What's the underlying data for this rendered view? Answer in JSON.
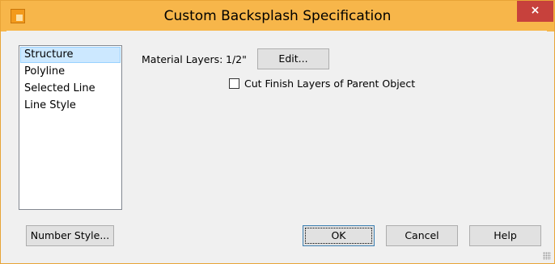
{
  "window": {
    "title": "Custom Backsplash Specification",
    "close_glyph": "×",
    "app_icon": "backsplash-app-icon"
  },
  "nav": {
    "items": [
      {
        "label": "Structure",
        "selected": true
      },
      {
        "label": "Polyline",
        "selected": false
      },
      {
        "label": "Selected Line",
        "selected": false
      },
      {
        "label": "Line Style",
        "selected": false
      }
    ]
  },
  "structure": {
    "material_layers_label": "Material Layers:",
    "material_layers_value": "1/2\"",
    "edit_button": "Edit...",
    "cut_finish_label": "Cut Finish Layers of Parent Object",
    "cut_finish_checked": false
  },
  "footer": {
    "number_style_button": "Number Style...",
    "ok_button": "OK",
    "cancel_button": "Cancel",
    "help_button": "Help"
  },
  "colors": {
    "titlebar": "#f7b64a",
    "close": "#c7413c",
    "selection": "#cce8ff"
  }
}
